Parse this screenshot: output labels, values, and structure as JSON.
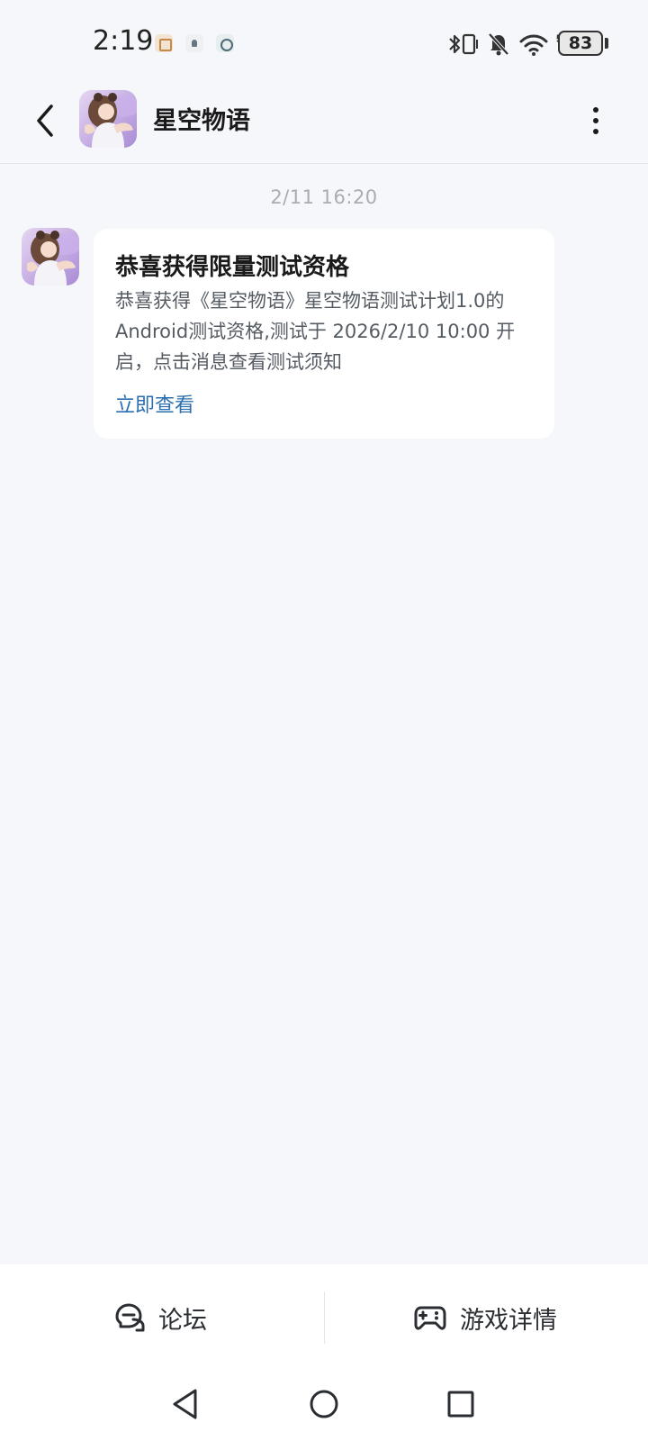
{
  "status_bar": {
    "time": "2:19",
    "battery_level": "83",
    "network_label": "5G",
    "icons": [
      "app-notification-icon",
      "app-notification-icon",
      "app-notification-icon",
      "bluetooth-icon",
      "vibrate-icon",
      "mute-icon",
      "wifi-icon",
      "signal-icon",
      "battery-icon"
    ]
  },
  "header": {
    "title": "星空物语",
    "back_icon": "back-arrow-icon",
    "more_icon": "more-vertical-icon"
  },
  "chat": {
    "timestamp": "2/11  16:20",
    "message": {
      "title": "恭喜获得限量测试资格",
      "body": "恭喜获得《星空物语》星空物语测试计划1.0的Android测试资格,测试于 2026/2/10 10:00 开启，点击消息查看测试须知",
      "link_label": "立即查看"
    }
  },
  "bottom_bar": {
    "forum_label": "论坛",
    "forum_icon": "forum-chat-icon",
    "detail_label": "游戏详情",
    "detail_icon": "gamepad-icon"
  },
  "nav_bar": {
    "icons": [
      "nav-back-icon",
      "nav-home-icon",
      "nav-recents-icon"
    ]
  },
  "colors": {
    "background": "#f5f7fa",
    "bubble": "#ffffff",
    "link": "#2b6fb0",
    "timestamp": "#a8adb4"
  }
}
